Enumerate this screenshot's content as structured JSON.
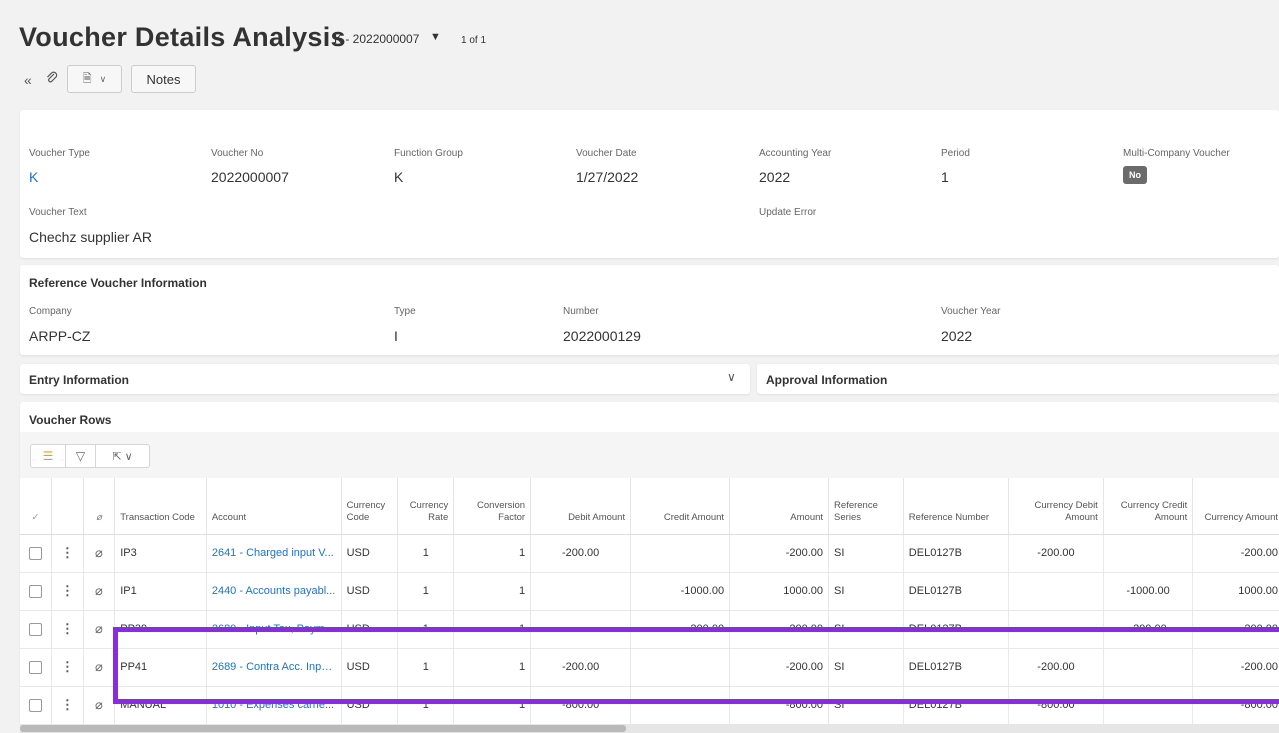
{
  "header": {
    "title": "Voucher Details Analysis",
    "record": "K - 2022000007",
    "record_count": "1 of 1",
    "notes_label": "Notes"
  },
  "voucher": {
    "fields": [
      {
        "label": "Voucher Type",
        "value": "K"
      },
      {
        "label": "Voucher No",
        "value": "2022000007"
      },
      {
        "label": "Function Group",
        "value": "K"
      },
      {
        "label": "Voucher Date",
        "value": "1/27/2022"
      },
      {
        "label": "Accounting Year",
        "value": "2022"
      },
      {
        "label": "Period",
        "value": "1"
      },
      {
        "label": "Multi-Company Voucher",
        "value": "No"
      }
    ],
    "text_label": "Voucher Text",
    "text_value": "Chechz supplier AR",
    "update_error_label": "Update Error"
  },
  "reference": {
    "title": "Reference Voucher Information",
    "fields": [
      {
        "label": "Company",
        "value": "ARPP-CZ"
      },
      {
        "label": "Type",
        "value": "I"
      },
      {
        "label": "Number",
        "value": "2022000129"
      },
      {
        "label": "Voucher Year",
        "value": "2022"
      }
    ]
  },
  "sections": {
    "entry": "Entry Information",
    "approval": "Approval Information",
    "rows_title": "Voucher Rows"
  },
  "table": {
    "columns": [
      "Transaction Code",
      "Account",
      "Currency Code",
      "Currency Rate",
      "Conversion Factor",
      "Debit Amount",
      "Credit Amount",
      "Amount",
      "Reference Series",
      "Reference Number",
      "Currency Debit Amount",
      "Currency Credit Amount",
      "Currency Amount"
    ],
    "rows": [
      [
        "IP3",
        "2641 - Charged input V...",
        "USD",
        "1",
        "1",
        "-200.00",
        "",
        "-200.00",
        "SI",
        "DEL0127B",
        "-200.00",
        "",
        "-200.00"
      ],
      [
        "IP1",
        "2440 - Accounts payabl...",
        "USD",
        "1",
        "1",
        "",
        "-1000.00",
        "1000.00",
        "SI",
        "DEL0127B",
        "",
        "-1000.00",
        "1000.00"
      ],
      [
        "PP39",
        "2680 - Input Tax, Paym...",
        "USD",
        "1",
        "1",
        "",
        "-200.00",
        "200.00",
        "SI",
        "DEL0127B",
        "",
        "-200.00",
        "200.00"
      ],
      [
        "PP41",
        "2689 - Contra Acc. Inpu...",
        "USD",
        "1",
        "1",
        "-200.00",
        "",
        "-200.00",
        "SI",
        "DEL0127B",
        "-200.00",
        "",
        "-200.00"
      ],
      [
        "MANUAL",
        "1010 - Expenses carrie...",
        "USD",
        "1",
        "1",
        "-800.00",
        "",
        "-800.00",
        "SI",
        "DEL0127B",
        "-800.00",
        "",
        "-800.00"
      ]
    ]
  },
  "colors": {
    "link": "#1a73c8",
    "highlight": "#8a2be2",
    "badge": "#6b6b6b"
  }
}
